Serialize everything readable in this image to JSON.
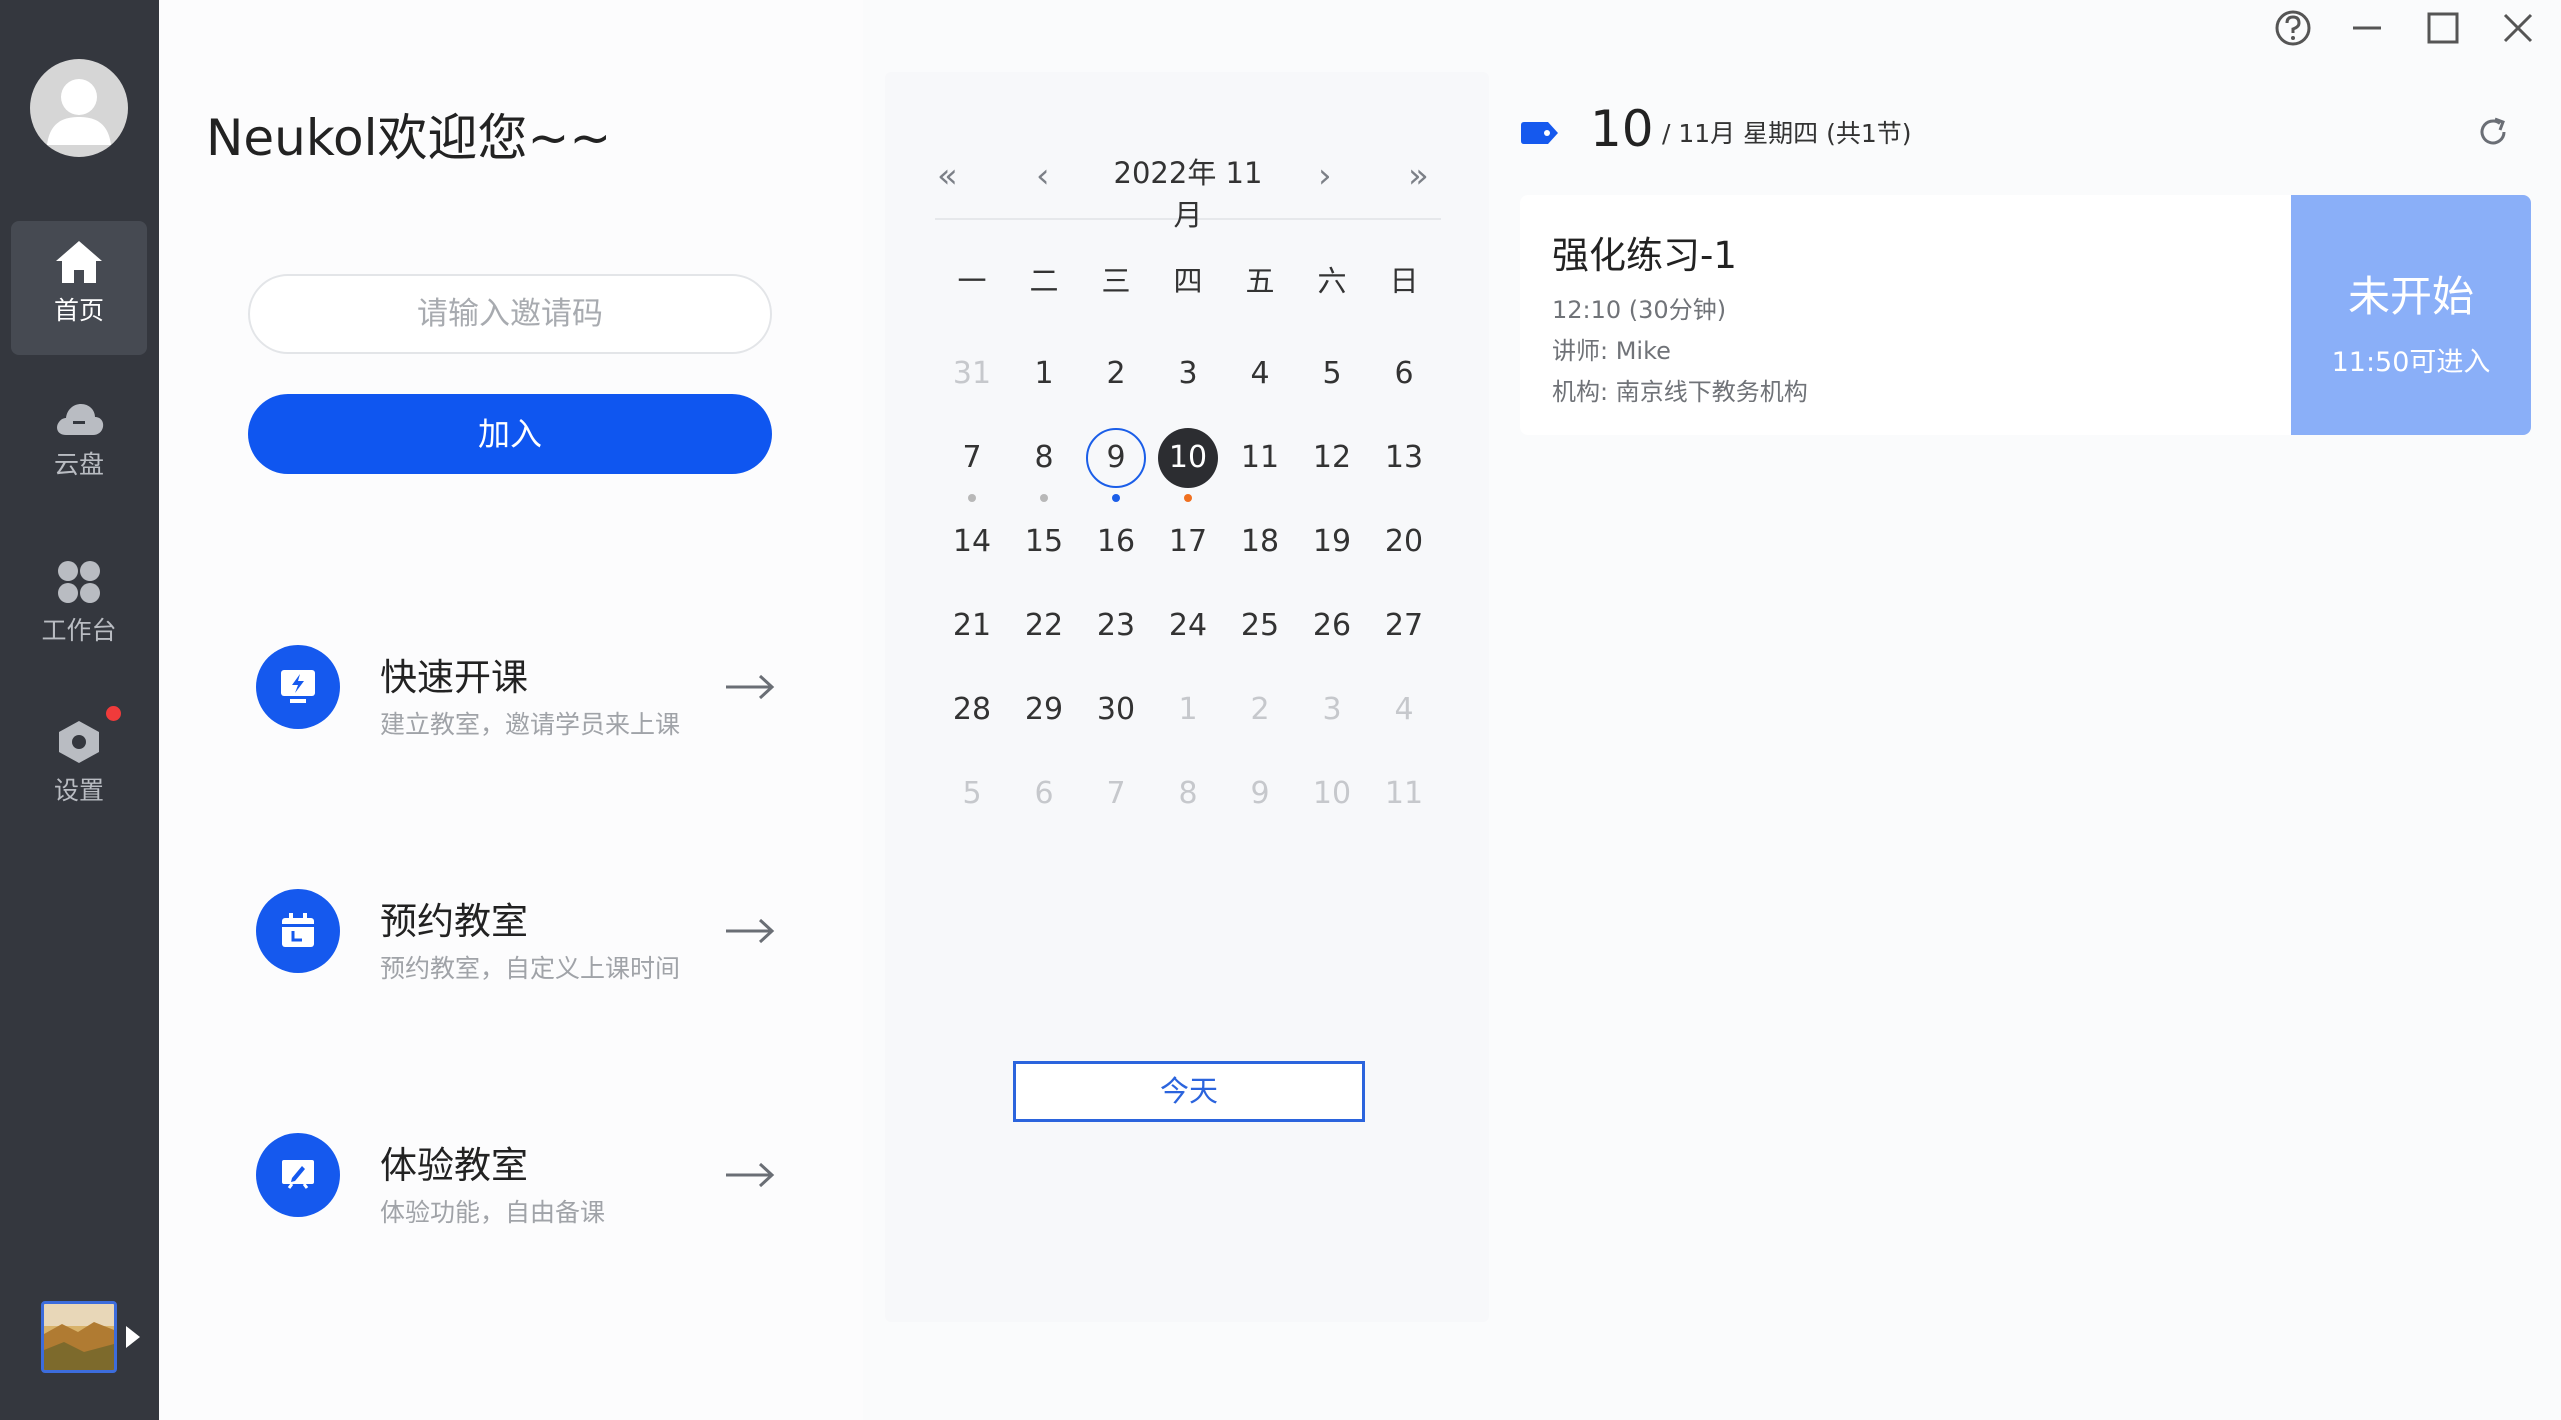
{
  "sidebar": {
    "items": [
      {
        "label": "首页",
        "icon": "home-icon",
        "active": true
      },
      {
        "label": "云盘",
        "icon": "cloud-icon",
        "active": false
      },
      {
        "label": "工作台",
        "icon": "workbench-icon",
        "active": false
      },
      {
        "label": "设置",
        "icon": "settings-icon",
        "active": false,
        "badge": true
      }
    ]
  },
  "welcome": "Neukol欢迎您~~",
  "invite": {
    "placeholder": "请输入邀请码"
  },
  "join_label": "加入",
  "actions": [
    {
      "title": "快速开课",
      "subtitle": "建立教室，邀请学员来上课",
      "icon": "quick-class-icon"
    },
    {
      "title": "预约教室",
      "subtitle": "预约教室，自定义上课时间",
      "icon": "calendar-icon"
    },
    {
      "title": "体验教室",
      "subtitle": "体验功能，自由备课",
      "icon": "whiteboard-icon"
    }
  ],
  "calendar": {
    "title": "2022年 11月",
    "weekdays": [
      "一",
      "二",
      "三",
      "四",
      "五",
      "六",
      "日"
    ],
    "days": [
      [
        "31",
        "1",
        "2",
        "3",
        "4",
        "5",
        "6"
      ],
      [
        "7",
        "8",
        "9",
        "10",
        "11",
        "12",
        "13"
      ],
      [
        "14",
        "15",
        "16",
        "17",
        "18",
        "19",
        "20"
      ],
      [
        "21",
        "22",
        "23",
        "24",
        "25",
        "26",
        "27"
      ],
      [
        "28",
        "29",
        "30",
        "1",
        "2",
        "3",
        "4"
      ],
      [
        "5",
        "6",
        "7",
        "8",
        "9",
        "10",
        "11"
      ]
    ],
    "today_label": "今天"
  },
  "schedule": {
    "day": "10",
    "meta": "/ 11月   星期四 (共1节)",
    "course": {
      "title": "强化练习-1",
      "time": "12:10   (30分钟)",
      "teacher": "讲师: Mike",
      "org": "机构: 南京线下教务机构",
      "status": "未开始",
      "enter_time": "11:50可进入"
    }
  },
  "colors": {
    "primary": "#0f56f0",
    "sidebar": "#34373e",
    "status_bg": "#8aaff8",
    "dot_blue": "#1b5ee8",
    "dot_orange": "#f07020",
    "dot_gray": "#b8b8b8"
  }
}
